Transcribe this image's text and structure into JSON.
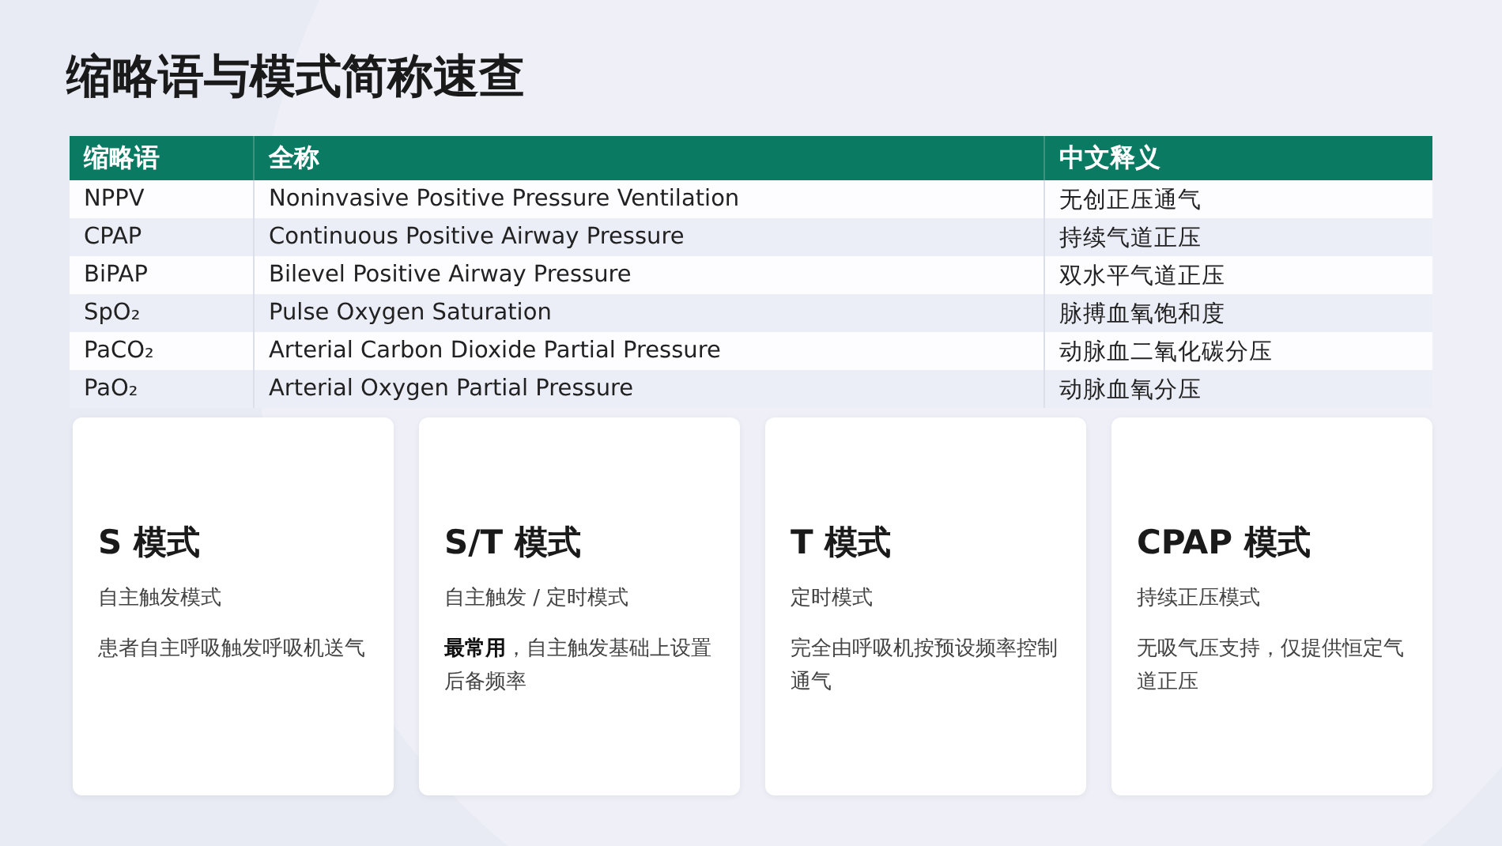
{
  "title": "缩略语与模式简称速查",
  "table": {
    "columns": [
      "缩略语",
      "全称",
      "中文释义"
    ],
    "rows": [
      [
        "NPPV",
        "Noninvasive Positive Pressure Ventilation",
        "无创正压通气"
      ],
      [
        "CPAP",
        "Continuous Positive Airway Pressure",
        "持续气道正压"
      ],
      [
        "BiPAP",
        "Bilevel Positive Airway Pressure",
        "双水平气道正压"
      ],
      [
        "SpO₂",
        "Pulse Oxygen Saturation",
        "脉搏血氧饱和度"
      ],
      [
        "PaCO₂",
        "Arterial Carbon Dioxide Partial Pressure",
        "动脉血二氧化碳分压"
      ],
      [
        "PaO₂",
        "Arterial Oxygen Partial Pressure",
        "动脉血氧分压"
      ]
    ]
  },
  "cards": [
    {
      "title": "S 模式",
      "subtitle": "自主触发模式",
      "description": "患者自主呼吸触发呼吸机送气"
    },
    {
      "title": "S/T 模式",
      "subtitle": "自主触发 / 定时模式",
      "description": "**最常用**，自主触发基础上设置后备频率"
    },
    {
      "title": "T 模式",
      "subtitle": "定时模式",
      "description": "完全由呼吸机按预设频率控制通气"
    },
    {
      "title": "CPAP 模式",
      "subtitle": "持续正压模式",
      "description": "无吸气压支持，仅提供恒定气道正压"
    }
  ]
}
